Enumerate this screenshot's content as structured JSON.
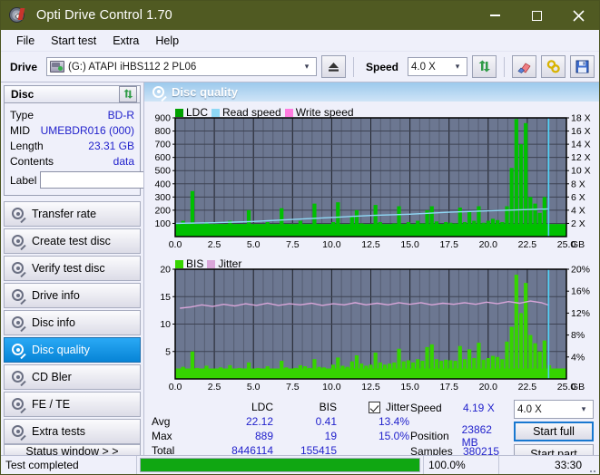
{
  "window": {
    "title": "Opti Drive Control 1.70",
    "icon": "optical-disc-icon",
    "minimize_label": "minimize",
    "maximize_label": "maximize",
    "close_label": "close"
  },
  "menu": {
    "items": [
      "File",
      "Start test",
      "Extra",
      "Help"
    ]
  },
  "toolbar": {
    "drive_label": "Drive",
    "drive_value": "(G:)  ATAPI iHBS112  2 PL06",
    "eject_icon": "eject-icon",
    "speed_label": "Speed",
    "speed_value": "4.0 X",
    "refresh_icon": "refresh-icon",
    "eraser_icon": "eraser-icon",
    "chain_icon": "chain-icon",
    "save_icon": "save-icon"
  },
  "disc_panel": {
    "title": "Disc",
    "refresh_icon": "refresh-icon",
    "rows": [
      {
        "key": "Type",
        "value": "BD-R"
      },
      {
        "key": "MID",
        "value": "UMEBDR016 (000)"
      },
      {
        "key": "Length",
        "value": "23.31 GB"
      },
      {
        "key": "Contents",
        "value": "data"
      }
    ],
    "label_key": "Label",
    "label_value": "",
    "label_button_icon": "disc-icon"
  },
  "sidebar": {
    "items": [
      {
        "label": "Transfer rate",
        "active": false
      },
      {
        "label": "Create test disc",
        "active": false
      },
      {
        "label": "Verify test disc",
        "active": false
      },
      {
        "label": "Drive info",
        "active": false
      },
      {
        "label": "Disc info",
        "active": false
      },
      {
        "label": "Disc quality",
        "active": true
      },
      {
        "label": "CD Bler",
        "active": false
      },
      {
        "label": "FE / TE",
        "active": false
      },
      {
        "label": "Extra tests",
        "active": false
      }
    ],
    "status_window_label": "Status window > >"
  },
  "panel": {
    "title": "Disc quality",
    "icon": "disc-quality-icon"
  },
  "stats": {
    "col_headers": [
      "LDC",
      "BIS",
      "Jitter"
    ],
    "jitter_checked": true,
    "rows": [
      {
        "label": "Avg",
        "ldc": "22.12",
        "bis": "0.41",
        "jitter": "13.4%"
      },
      {
        "label": "Max",
        "ldc": "889",
        "bis": "19",
        "jitter": "15.0%"
      },
      {
        "label": "Total",
        "ldc": "8446114",
        "bis": "155415",
        "jitter": ""
      }
    ]
  },
  "readout": {
    "speed_key": "Speed",
    "speed_value": "4.19 X",
    "position_key": "Position",
    "position_value": "23862 MB",
    "samples_key": "Samples",
    "samples_value": "380215",
    "speed_select": "4.0 X",
    "start_full_label": "Start full",
    "start_part_label": "Start part"
  },
  "statusbar": {
    "message": "Test completed",
    "progress_percent": 100.0,
    "progress_label": "100.0%",
    "elapsed": "33:30"
  },
  "colors": {
    "accent": "#0784d6",
    "ldc_green": "#00c000",
    "read_speed": "#8fd8f5",
    "write_speed": "#ff7ce0",
    "bis_green": "#36d400",
    "jitter": "#d9a6d9",
    "plot_bg": "#6c7791",
    "link_blue": "#2222cc",
    "titlebar": "#505a22"
  },
  "chart_data": [
    {
      "type": "area",
      "name": "ldc-chart",
      "title": "",
      "xlabel": "GB",
      "ylabel": "",
      "xlim": [
        0,
        25
      ],
      "ylim": [
        0,
        900
      ],
      "y2lim": [
        0,
        18
      ],
      "y2label": "X",
      "xticks": [
        "0.0",
        "2.5",
        "5.0",
        "7.5",
        "10.0",
        "12.5",
        "15.0",
        "17.5",
        "20.0",
        "22.5",
        "25.0"
      ],
      "yticks": [
        100,
        200,
        300,
        400,
        500,
        600,
        700,
        800,
        900
      ],
      "y2ticks": [
        "2 X",
        "4 X",
        "6 X",
        "8 X",
        "10 X",
        "12 X",
        "14 X",
        "16 X",
        "18 X"
      ],
      "grid": true,
      "legend": [
        {
          "label": "LDC",
          "color": "#00a000"
        },
        {
          "label": "Read speed",
          "color": "#8fd8f5"
        },
        {
          "label": "Write speed",
          "color": "#ff7ce0"
        }
      ],
      "marker_x": 23.86,
      "series": [
        {
          "name": "LDC",
          "type": "bar",
          "color": "#00c000",
          "x": [
            0.2,
            0.5,
            0.8,
            1.1,
            1.4,
            1.7,
            2.0,
            2.3,
            2.6,
            2.9,
            3.2,
            3.5,
            3.8,
            4.1,
            4.4,
            4.7,
            5.0,
            5.3,
            5.6,
            5.9,
            6.2,
            6.5,
            6.8,
            7.1,
            7.4,
            7.7,
            8.0,
            8.3,
            8.6,
            8.9,
            9.2,
            9.5,
            9.8,
            10.1,
            10.4,
            10.7,
            11.0,
            11.3,
            11.6,
            11.9,
            12.2,
            12.5,
            12.8,
            13.1,
            13.4,
            13.7,
            14.0,
            14.3,
            14.6,
            14.9,
            15.2,
            15.5,
            15.8,
            16.1,
            16.4,
            16.7,
            17.0,
            17.3,
            17.6,
            17.9,
            18.2,
            18.5,
            18.8,
            19.1,
            19.4,
            19.7,
            20.0,
            20.3,
            20.6,
            20.9,
            21.2,
            21.5,
            21.8,
            22.1,
            22.4,
            22.7,
            23.0,
            23.3,
            23.6,
            23.9
          ],
          "values": [
            60,
            120,
            75,
            345,
            90,
            70,
            110,
            85,
            70,
            95,
            80,
            120,
            75,
            95,
            85,
            200,
            70,
            90,
            80,
            110,
            85,
            70,
            215,
            95,
            80,
            90,
            120,
            85,
            75,
            250,
            95,
            80,
            70,
            110,
            260,
            90,
            80,
            150,
            200,
            100,
            85,
            95,
            240,
            110,
            80,
            90,
            100,
            230,
            95,
            110,
            85,
            120,
            100,
            200,
            230,
            115,
            95,
            110,
            105,
            100,
            220,
            110,
            190,
            120,
            230,
            105,
            120,
            135,
            125,
            110,
            230,
            520,
            890,
            700,
            860,
            300,
            250,
            180,
            300,
            80
          ]
        },
        {
          "name": "Read speed",
          "type": "line",
          "color": "#8fd8f5",
          "x": [
            0.0,
            2.5,
            5.0,
            7.5,
            10.0,
            12.5,
            15.0,
            17.5,
            20.0,
            22.5,
            23.9
          ],
          "values": [
            2.0,
            2.1,
            2.3,
            2.6,
            2.9,
            3.2,
            3.4,
            3.7,
            3.9,
            4.1,
            4.19
          ]
        },
        {
          "name": "Write speed",
          "type": "line",
          "color": "#ff7ce0",
          "x": [],
          "values": []
        }
      ]
    },
    {
      "type": "area",
      "name": "bis-jitter-chart",
      "title": "",
      "xlabel": "GB",
      "ylabel": "",
      "xlim": [
        0,
        25
      ],
      "ylim": [
        0,
        20
      ],
      "y2lim": [
        0,
        20
      ],
      "y2label": "%",
      "xticks": [
        "0.0",
        "2.5",
        "5.0",
        "7.5",
        "10.0",
        "12.5",
        "15.0",
        "17.5",
        "20.0",
        "22.5",
        "25.0"
      ],
      "yticks": [
        5,
        10,
        15,
        20
      ],
      "y2ticks": [
        "4%",
        "8%",
        "12%",
        "16%",
        "20%"
      ],
      "grid": true,
      "legend": [
        {
          "label": "BIS",
          "color": "#36d400"
        },
        {
          "label": "Jitter",
          "color": "#d9a6d9"
        }
      ],
      "marker_x": 23.86,
      "series": [
        {
          "name": "BIS",
          "type": "bar",
          "color": "#36d400",
          "x": [
            0.2,
            0.5,
            0.8,
            1.1,
            1.4,
            1.7,
            2.0,
            2.3,
            2.6,
            2.9,
            3.2,
            3.5,
            3.8,
            4.1,
            4.4,
            4.7,
            5.0,
            5.3,
            5.6,
            5.9,
            6.2,
            6.5,
            6.8,
            7.1,
            7.4,
            7.7,
            8.0,
            8.3,
            8.6,
            8.9,
            9.2,
            9.5,
            9.8,
            10.1,
            10.4,
            10.7,
            11.0,
            11.3,
            11.6,
            11.9,
            12.2,
            12.5,
            12.8,
            13.1,
            13.4,
            13.7,
            14.0,
            14.3,
            14.6,
            14.9,
            15.2,
            15.5,
            15.8,
            16.1,
            16.4,
            16.7,
            17.0,
            17.3,
            17.6,
            17.9,
            18.2,
            18.5,
            18.8,
            19.1,
            19.4,
            19.7,
            20.0,
            20.3,
            20.6,
            20.9,
            21.2,
            21.5,
            21.8,
            22.1,
            22.4,
            22.7,
            23.0,
            23.3,
            23.6,
            23.9
          ],
          "values": [
            1.5,
            2.2,
            1.8,
            5.0,
            2.0,
            1.6,
            2.4,
            1.9,
            1.7,
            2.1,
            1.8,
            2.5,
            1.7,
            2.0,
            1.9,
            3.0,
            1.6,
            2.0,
            1.8,
            2.3,
            1.9,
            1.7,
            3.3,
            2.1,
            1.8,
            2.0,
            2.5,
            2.3,
            2.0,
            3.6,
            2.2,
            2.1,
            1.9,
            2.6,
            3.9,
            2.4,
            2.2,
            3.2,
            4.3,
            2.8,
            2.4,
            2.6,
            4.8,
            3.0,
            2.6,
            2.8,
            3.0,
            5.5,
            3.2,
            3.4,
            3.0,
            3.6,
            3.3,
            5.8,
            6.3,
            3.6,
            3.3,
            3.5,
            3.4,
            3.3,
            6.0,
            3.6,
            5.4,
            3.8,
            6.6,
            3.5,
            3.8,
            4.2,
            4.0,
            3.6,
            6.8,
            9.5,
            19.0,
            12.0,
            17.5,
            8.0,
            6.5,
            5.0,
            7.0,
            2.5
          ]
        },
        {
          "name": "Jitter",
          "type": "line",
          "color": "#d9a6d9",
          "x": [
            0.3,
            1.0,
            1.7,
            2.4,
            3.1,
            3.8,
            4.5,
            5.2,
            5.9,
            6.6,
            7.3,
            8.0,
            8.7,
            9.4,
            10.1,
            10.8,
            11.5,
            12.2,
            12.9,
            13.6,
            14.3,
            15.0,
            15.7,
            16.4,
            17.1,
            17.8,
            18.5,
            19.2,
            19.9,
            20.6,
            21.3,
            22.0,
            22.7,
            23.4,
            23.9
          ],
          "values": [
            12.9,
            13.1,
            13.5,
            13.2,
            13.6,
            13.3,
            13.7,
            13.4,
            13.8,
            13.4,
            13.7,
            13.5,
            13.8,
            13.4,
            13.7,
            13.5,
            13.9,
            13.5,
            13.8,
            13.5,
            13.9,
            13.6,
            13.9,
            13.5,
            13.8,
            13.6,
            13.9,
            13.6,
            14.0,
            13.7,
            14.1,
            13.8,
            14.2,
            13.9,
            13.4
          ]
        }
      ]
    }
  ]
}
